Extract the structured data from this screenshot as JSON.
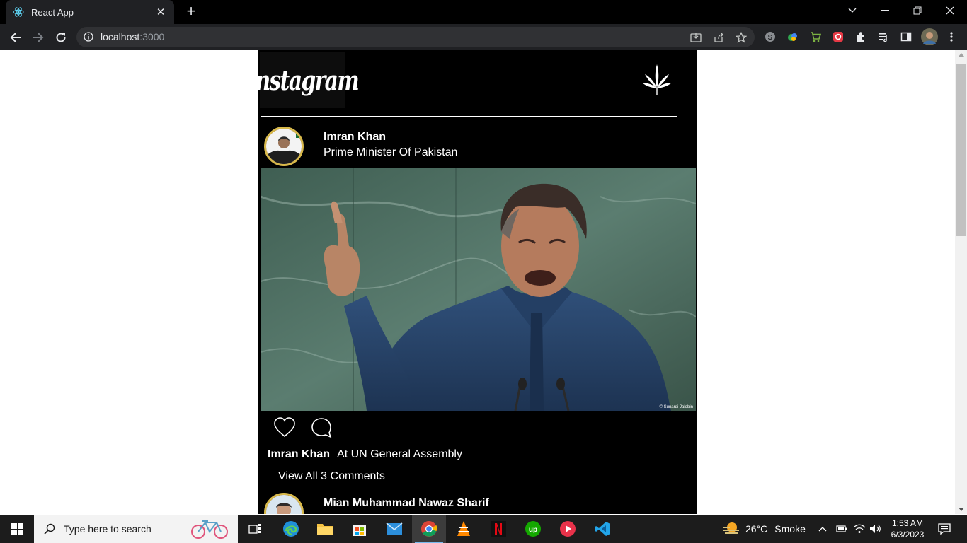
{
  "browser": {
    "tab_title": "React App",
    "url_host": "localhost",
    "url_port": ":3000"
  },
  "page": {
    "logo_text": "Instagram",
    "posts": [
      {
        "username": "Imran Khan",
        "subtitle": "Prime Minister Of Pakistan",
        "caption_user": "Imran Khan",
        "caption_text": "At UN General Assembly",
        "view_comments": "View All 3 Comments",
        "image_credit": "© Sunardi Jalobin"
      },
      {
        "username": "Mian Muhammad Nawaz Sharif"
      }
    ]
  },
  "taskbar": {
    "search_placeholder": "Type here to search",
    "weather_temp": "26°C",
    "weather_desc": "Smoke",
    "time": "1:53 AM",
    "date": "6/3/2023"
  },
  "colors": {
    "chrome_dark": "#202124",
    "feed_bg": "#000000",
    "taskbar_bg": "#1c1c1c",
    "avatar_ring": "#d7b84a"
  }
}
